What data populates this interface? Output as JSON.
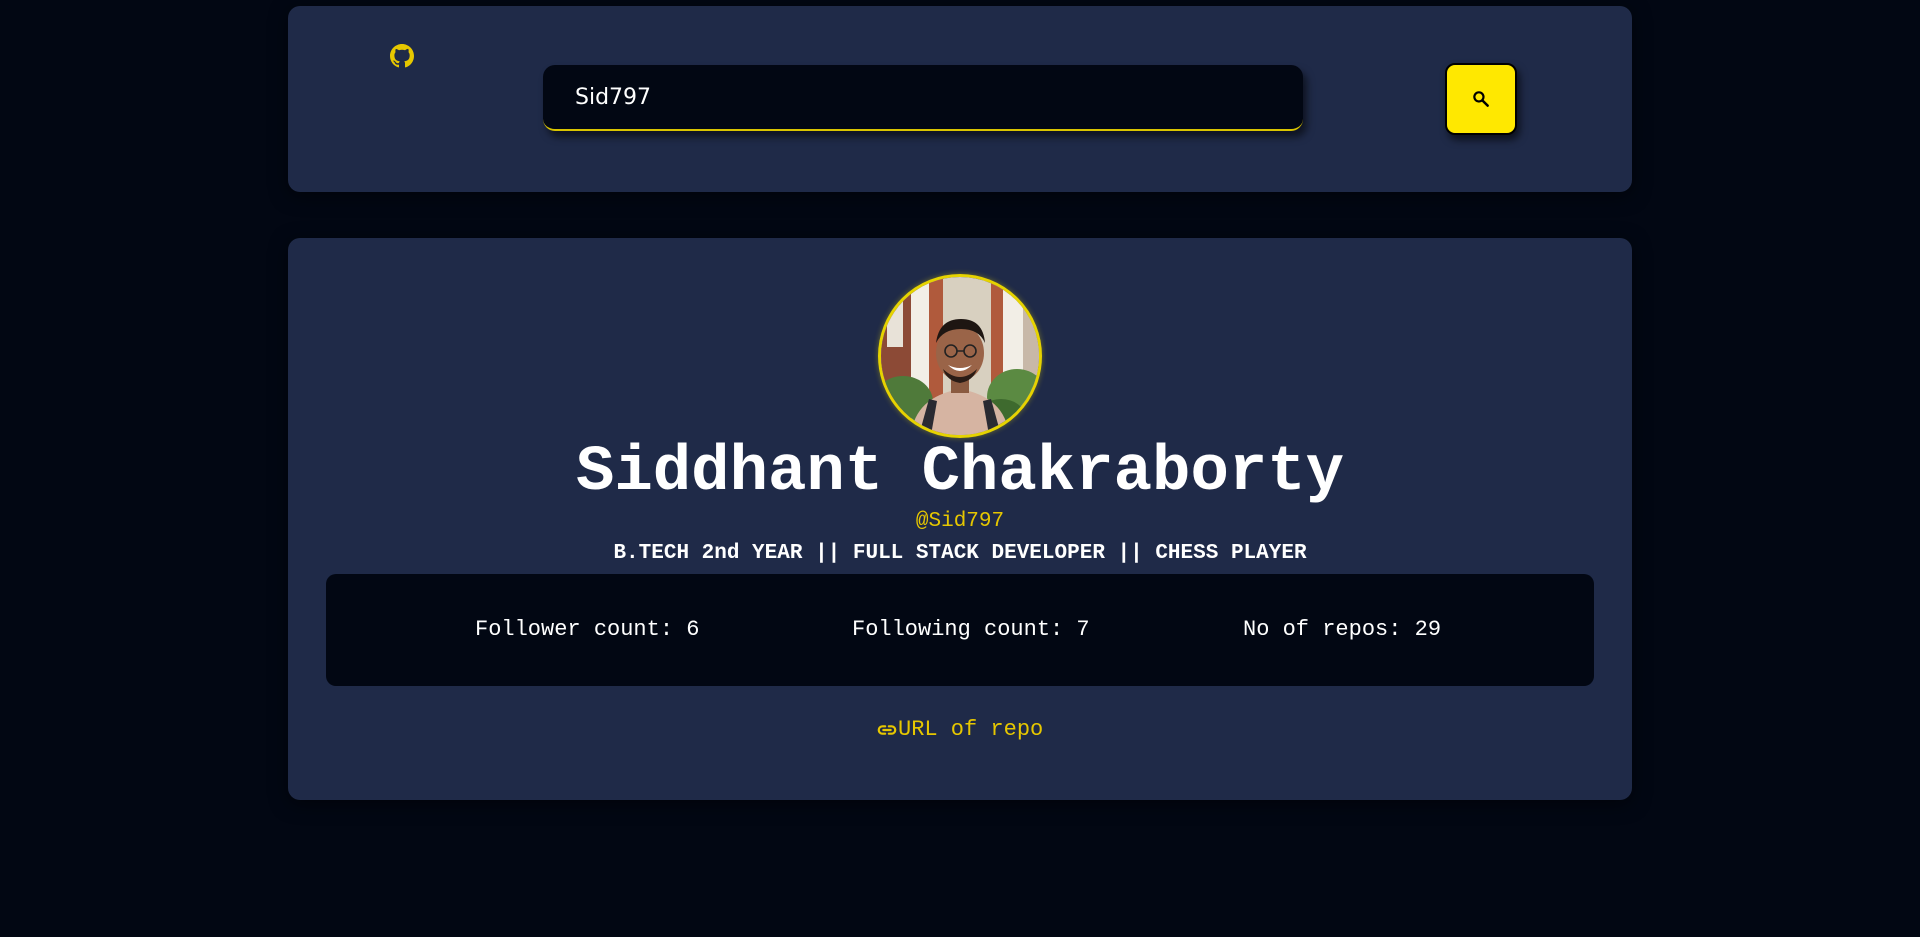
{
  "search": {
    "value": "Sid797",
    "placeholder": ""
  },
  "profile": {
    "name": "Siddhant Chakraborty",
    "handle": "@Sid797",
    "bio": "B.TECH 2nd YEAR || FULL STACK DEVELOPER || CHESS PLAYER",
    "avatar_icon": "user-avatar-photo"
  },
  "stats": {
    "followers_label": "Follower count: 6",
    "following_label": "Following count: 7",
    "repos_label": "No of repos: 29"
  },
  "link": {
    "label": "URL of repo",
    "icon": "link-icon"
  },
  "icons": {
    "logo": "github-icon",
    "search": "search-icon"
  },
  "colors": {
    "background": "#020713",
    "card": "#1f2a48",
    "accent": "#ffe800",
    "text": "#ffffff"
  }
}
